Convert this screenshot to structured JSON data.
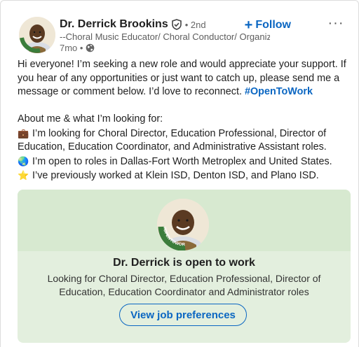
{
  "post": {
    "author": {
      "name": "Dr. Derrick Brookins",
      "degree": "• 2nd",
      "headline": "--Choral Music Educator/ Choral Conductor/ Organizat...",
      "time": "7mo •"
    },
    "follow_label": "Follow",
    "follow_icon": "plus-icon",
    "more_icon": "more-dots-icon",
    "more_glyph": "···",
    "body": {
      "intro": "Hi everyone! I’m seeking a new role and would appreciate your support. If you hear of any opportunities or just want to catch up, please send me a message or comment below. I’d love to reconnect.",
      "hashtag": "#OpenToWork",
      "about_heading": "About me & what I’m looking for:",
      "items": [
        {
          "icon": "briefcase-icon",
          "glyph": "💼",
          "text": "I’m looking for Choral Director, Education Professional, Director of Education, Education Coordinator, and Administrative Assistant roles."
        },
        {
          "icon": "globe-icon",
          "glyph": "🌏",
          "text": "I’m open to roles in Dallas-Fort Worth Metroplex and United States."
        },
        {
          "icon": "star-icon",
          "glyph": "⭐",
          "text": "I’ve previously worked at Klein ISD, Denton ISD, and Plano ISD."
        }
      ]
    },
    "open_to_work_card": {
      "badge_text": "#OPENTOWORK",
      "title": "Dr. Derrick is open to work",
      "description": "Looking for Choral Director, Education Professional, Director of Education, Education Coordinator and Administrator roles",
      "button_label": "View job preferences"
    }
  },
  "colors": {
    "brand_blue": "#0a66c2",
    "open_to_work_green": "#3b7d3b",
    "card_bg": "#e3efde"
  }
}
